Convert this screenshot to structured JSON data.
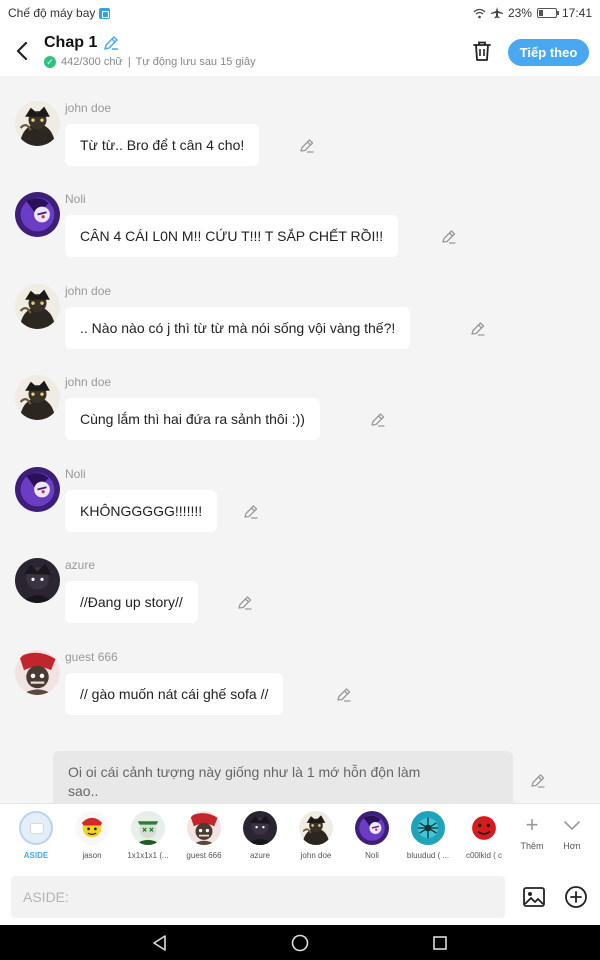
{
  "status_bar": {
    "mode": "Chế độ máy bay",
    "battery": "23%",
    "battery_level": 0.23,
    "time": "17:41"
  },
  "header": {
    "title": "Chap 1",
    "word_count": "442/300 chữ",
    "separator": "|",
    "autosave": "Tự động lưu sau 15 giây",
    "next_label": "Tiếp theo"
  },
  "messages": [
    {
      "name": "john doe",
      "text": "Từ từ.. Bro để t cân 4 cho!",
      "avatar": "john-doe"
    },
    {
      "name": "Noli",
      "text": "CÂN 4 CÁI L0N M!! CỨU T!!! T SẮP CHẾT RỒI!!",
      "avatar": "noli"
    },
    {
      "name": "john doe",
      "text": ".. Nào nào có j thì từ từ mà nói sống vội vàng thế?!",
      "avatar": "john-doe"
    },
    {
      "name": "john doe",
      "text": "Cùng lắm thì hai đứa ra sảnh thôi :))",
      "avatar": "john-doe"
    },
    {
      "name": "Noli",
      "text": "KHÔNGGGGG!!!!!!!",
      "avatar": "noli"
    },
    {
      "name": "azure",
      "text": "//Đang up story//",
      "avatar": "azure"
    },
    {
      "name": "guest 666",
      "text": "// gào muốn nát cái ghế sofa //",
      "avatar": "guest-666"
    }
  ],
  "aside_message": {
    "line1": "Oi oi cái cảnh tượng này giống như là 1 mớ hỗn độn làm",
    "line2": "sao.."
  },
  "characters": [
    {
      "label": "ASIDE",
      "avatar": "aside"
    },
    {
      "label": "jason",
      "avatar": "jason"
    },
    {
      "label": "1x1x1x1 (...",
      "avatar": "1x1x1x1"
    },
    {
      "label": "guest 666",
      "avatar": "guest-666"
    },
    {
      "label": "azure",
      "avatar": "azure"
    },
    {
      "label": "john doe",
      "avatar": "john-doe"
    },
    {
      "label": "Noli",
      "avatar": "noli"
    },
    {
      "label": "bluudud ( ...",
      "avatar": "bluudud"
    },
    {
      "label": "c00lkid ( c",
      "avatar": "c00lkid"
    }
  ],
  "controls": {
    "more_label": "Thêm",
    "less_label": "Hơn"
  },
  "input": {
    "placeholder": "ASIDE:"
  },
  "icons": [
    "back-arrow-icon",
    "pencil-icon",
    "check-icon",
    "trash-icon",
    "edit-icon",
    "plus-icon",
    "chevron-down-icon",
    "image-icon",
    "add-circle-icon",
    "nav-back-icon",
    "nav-home-icon",
    "nav-recent-icon"
  ],
  "colors": {
    "accent": "#4aa8f0",
    "background": "#f4f4f4",
    "bubble": "#ffffff",
    "aside_bubble": "#e8e8e8",
    "check": "#2ec27e"
  }
}
